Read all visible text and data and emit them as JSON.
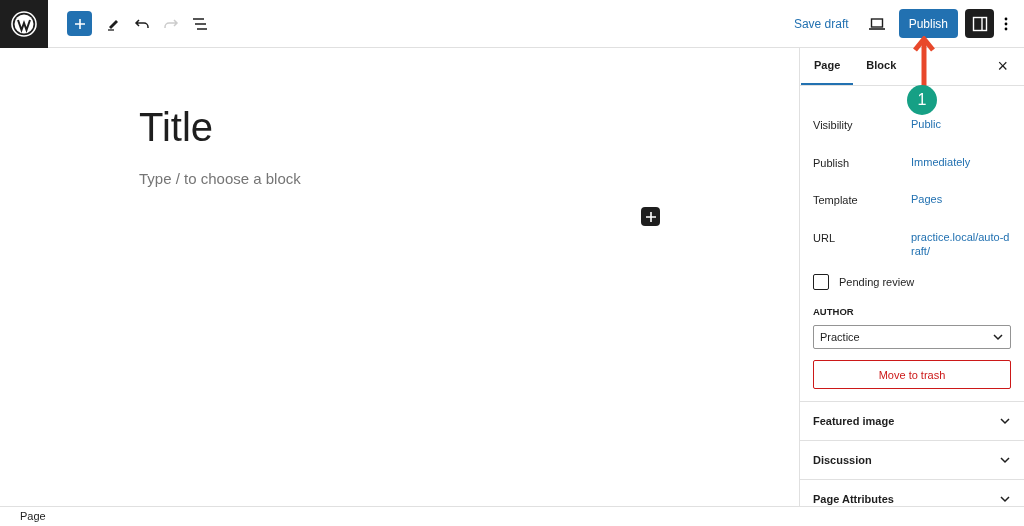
{
  "toolbar": {
    "save_label": "Save draft",
    "publish_label": "Publish",
    "settings_on": true
  },
  "editor": {
    "title": "Title",
    "block_placeholder": "Type / to choose a block"
  },
  "sidebar": {
    "tabs": [
      {
        "label": "Page",
        "selected": true
      },
      {
        "label": "Block",
        "selected": false
      }
    ],
    "close": "×",
    "summary": {
      "rows": [
        {
          "label": "Visibility",
          "value": "Public"
        },
        {
          "label": "Publish",
          "value": "Immediately"
        },
        {
          "label": "Template",
          "value": "Pages"
        },
        {
          "label": "URL",
          "value": "practice.local/auto-draft/"
        }
      ],
      "pending_review": {
        "label": "Pending review",
        "checked": false
      },
      "author_label": "AUTHOR",
      "author": "Practice",
      "trash": "Move to trash"
    },
    "panels": [
      {
        "title": "Featured image",
        "expanded": false
      },
      {
        "title": "Discussion",
        "expanded": false
      },
      {
        "title": "Page Attributes",
        "expanded": false
      }
    ]
  },
  "annotation": {
    "number": "1"
  },
  "status_bar": {
    "breadcrumb": "Page"
  }
}
